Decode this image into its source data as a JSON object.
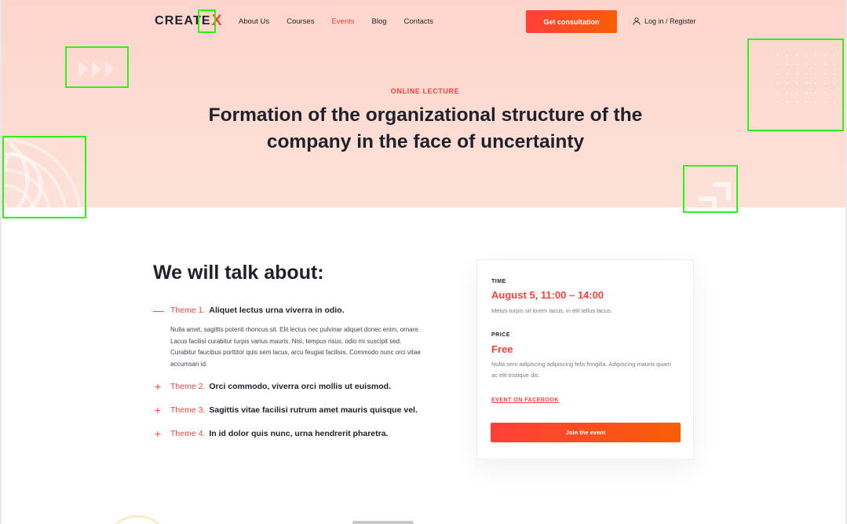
{
  "header": {
    "logo_text": "CREATE",
    "logo_accent": "X",
    "nav": [
      "About Us",
      "Courses",
      "Events",
      "Blog",
      "Contacts"
    ],
    "active_nav": "Events",
    "cta_label": "Get consultation",
    "login_label": "Log in / Register"
  },
  "hero": {
    "eyebrow": "ONLINE LECTURE",
    "title": "Formation of the organizational structure of the company in the face of uncertainty"
  },
  "talk": {
    "heading": "We will talk about:",
    "themes": [
      {
        "number": "Theme 1.",
        "title": "Aliquet lectus urna viverra in odio.",
        "expanded": true,
        "sign": "—",
        "body": "Nulla amet, sagittis potenti rhoncus sit. Elit lectus nec pulvinar aliquet donec enim, ornare. Lacus facilisi curabitur turpis varius mauris. Nisi, tempus risus, odio mi suscipit sed. Curabitur faucibus porttitor quis sem lacus, arcu feugiat facilisis. Commodo nunc orci vitae accumsan id."
      },
      {
        "number": "Theme 2.",
        "title": "Orci commodo, viverra orci mollis ut euismod.",
        "expanded": false,
        "sign": "+"
      },
      {
        "number": "Theme 3.",
        "title": "Sagittis vitae facilisi rutrum amet mauris quisque vel.",
        "expanded": false,
        "sign": "+"
      },
      {
        "number": "Theme 4.",
        "title": "In id dolor quis nunc, urna hendrerit pharetra.",
        "expanded": false,
        "sign": "+"
      }
    ]
  },
  "event_card": {
    "time_label": "TIME",
    "time_value": "August 5, 11:00 – 14:00",
    "time_text": "Metus turpis sit lorem lacus, in elit tellus lacus.",
    "price_label": "PRICE",
    "price_value": "Free",
    "price_text": "Nulla sem adipiscing adipiscing felis fringilla. Adipiscing mauris quam ac elit tristique dis.",
    "facebook_link": "EVENT ON FACEBOOK",
    "join_label": "Join the event"
  },
  "colors": {
    "accent": "#ff3f3a",
    "accent_2": "#f75e05",
    "dark": "#1e212c",
    "hero_bg": "#fdd5cc",
    "highlight": "#2ff21a"
  },
  "icons": [
    "user-icon",
    "minus-icon",
    "plus-icon",
    "triangles-icon",
    "dots-grid-icon",
    "arc-rings-icon",
    "corner-arrow-icon"
  ]
}
